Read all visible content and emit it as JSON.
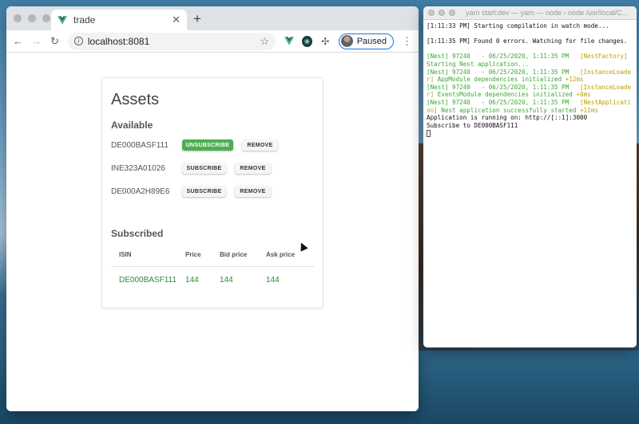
{
  "browser": {
    "tab_title": "trade",
    "url": "localhost:8081",
    "profile_label": "Paused"
  },
  "assets": {
    "title": "Assets",
    "available_heading": "Available",
    "available": [
      {
        "isin": "DE000BASF111",
        "subscribe_label": "UNSUBSCRIBE",
        "remove_label": "REMOVE",
        "subscribed": true
      },
      {
        "isin": "INE323A01026",
        "subscribe_label": "SUBSCRIBE",
        "remove_label": "REMOVE",
        "subscribed": false
      },
      {
        "isin": "DE000A2H89E6",
        "subscribe_label": "SUBSCRIBE",
        "remove_label": "REMOVE",
        "subscribed": false
      }
    ],
    "subscribed_heading": "Subscribed",
    "table": {
      "headers": [
        "ISIN",
        "Price",
        "Bid price",
        "Ask price"
      ],
      "rows": [
        [
          "DE000BASF111",
          "144",
          "144",
          "144"
        ]
      ]
    }
  },
  "terminal": {
    "title": "yarn start:dev — yarn — node › node /usr/local/C...",
    "lines": [
      [
        {
          "t": "[1:11:33 PM] Starting compilation in watch mode...",
          "c": ""
        }
      ],
      [
        {
          "t": "",
          "c": ""
        }
      ],
      [
        {
          "t": "[1:11:35 PM] Found 0 errors. Watching for file changes.",
          "c": ""
        }
      ],
      [
        {
          "t": "",
          "c": ""
        }
      ],
      [
        {
          "t": "[Nest] 97240   - 06/25/2020, 1:11:35 PM   ",
          "c": "g"
        },
        {
          "t": "[NestFactory] ",
          "c": "y"
        },
        {
          "t": "Starting Nest application...",
          "c": "g"
        }
      ],
      [
        {
          "t": "[Nest] 97240   - 06/25/2020, 1:11:35 PM   ",
          "c": "g"
        },
        {
          "t": "[InstanceLoader] ",
          "c": "y"
        },
        {
          "t": "AppModule dependencies initialized ",
          "c": "g"
        },
        {
          "t": "+12ms",
          "c": "y"
        }
      ],
      [
        {
          "t": "[Nest] 97240   - 06/25/2020, 1:11:35 PM   ",
          "c": "g"
        },
        {
          "t": "[InstanceLoader] ",
          "c": "y"
        },
        {
          "t": "EventsModule dependencies initialized ",
          "c": "g"
        },
        {
          "t": "+0ms",
          "c": "y"
        }
      ],
      [
        {
          "t": "[Nest] 97240   - 06/25/2020, 1:11:35 PM   ",
          "c": "g"
        },
        {
          "t": "[NestApplication] ",
          "c": "y"
        },
        {
          "t": "Nest application successfully started ",
          "c": "g"
        },
        {
          "t": "+11ms",
          "c": "y"
        }
      ],
      [
        {
          "t": "Application is running on: http://[::1]:3000",
          "c": ""
        }
      ],
      [
        {
          "t": "Subscribe to DE000BASF111",
          "c": ""
        }
      ]
    ]
  }
}
